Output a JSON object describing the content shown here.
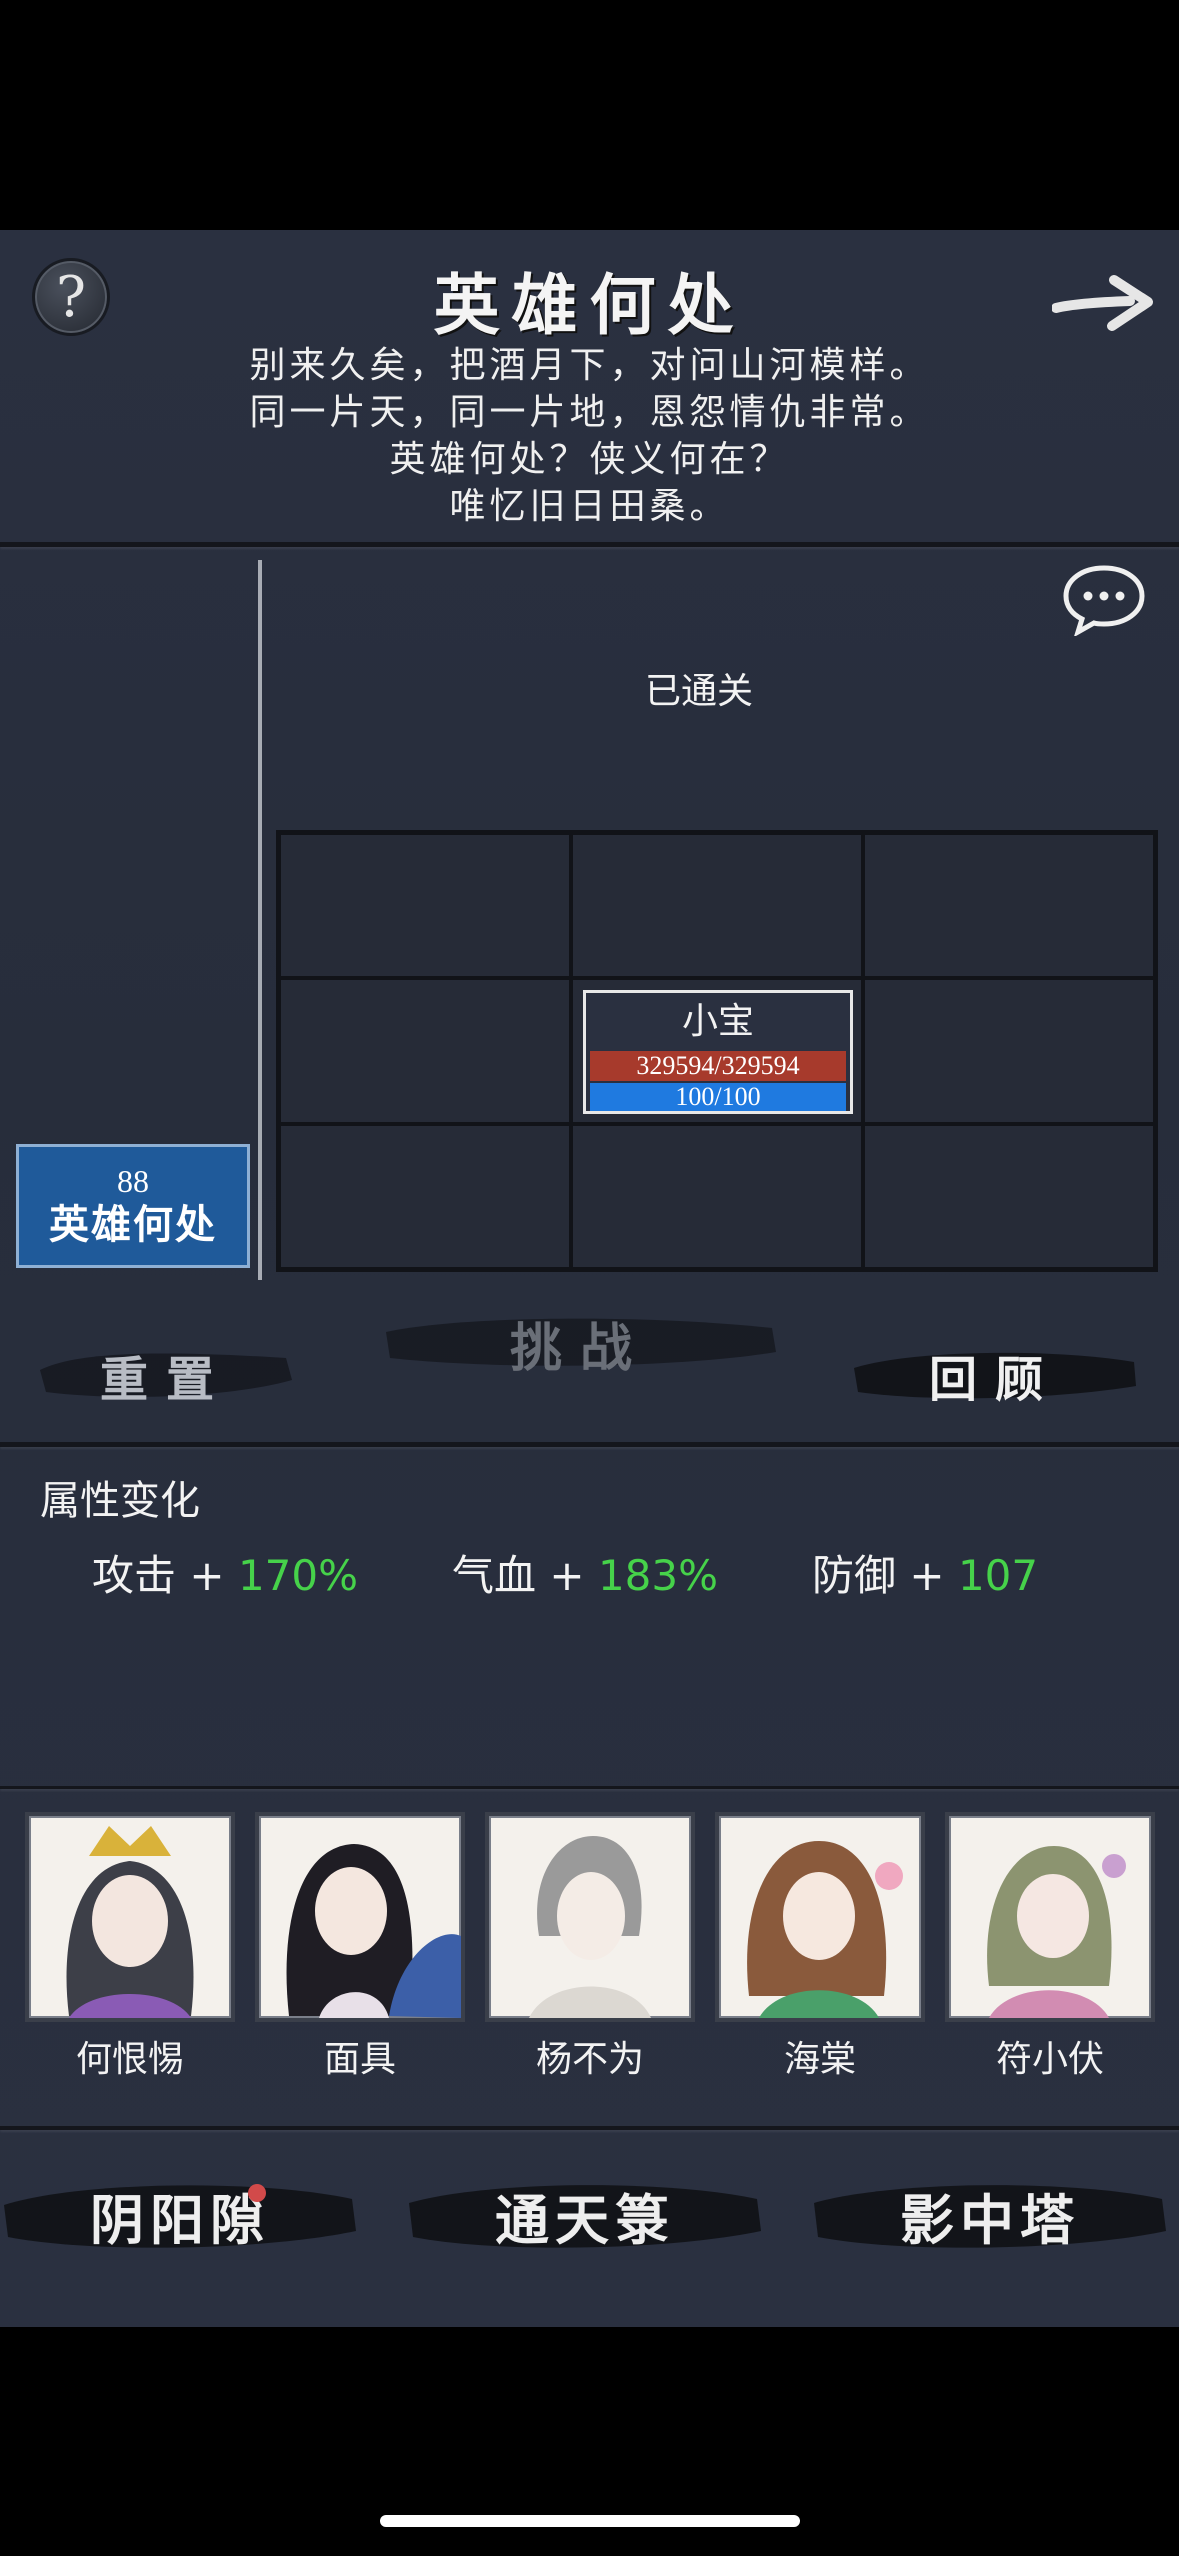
{
  "header": {
    "title": "英雄何处",
    "poem": [
      "别来久矣，把酒月下，对问山河模样。",
      "同一片天，同一片地，恩怨情仇非常。",
      "英雄何处？侠义何在？",
      "唯忆旧日田桑。"
    ],
    "help_label": "?"
  },
  "stage": {
    "number": "88",
    "name": "英雄何处",
    "status": "已通关"
  },
  "unit": {
    "name": "小宝",
    "hp": "329594/329594",
    "mp": "100/100"
  },
  "actions": {
    "reset": "重置",
    "challenge": "挑战",
    "review": "回顾"
  },
  "attributes": {
    "title": "属性变化",
    "items": [
      {
        "label": "攻击",
        "sign": "+",
        "value": "170%"
      },
      {
        "label": "气血",
        "sign": "+",
        "value": "183%"
      },
      {
        "label": "防御",
        "sign": "+",
        "value": "107"
      }
    ]
  },
  "heroes": [
    {
      "name": "何恨惕"
    },
    {
      "name": "面具"
    },
    {
      "name": "杨不为"
    },
    {
      "name": "海棠"
    },
    {
      "name": "符小伏"
    }
  ],
  "nav": {
    "yinyang": "阴阳隙",
    "tongtian": "通天箓",
    "yingzhong": "影中塔"
  },
  "colors": {
    "accent_green": "#46d24a",
    "hp_red": "#a73a2c",
    "mp_blue": "#1f7ae0",
    "stage_blue": "#1f5a9a"
  }
}
